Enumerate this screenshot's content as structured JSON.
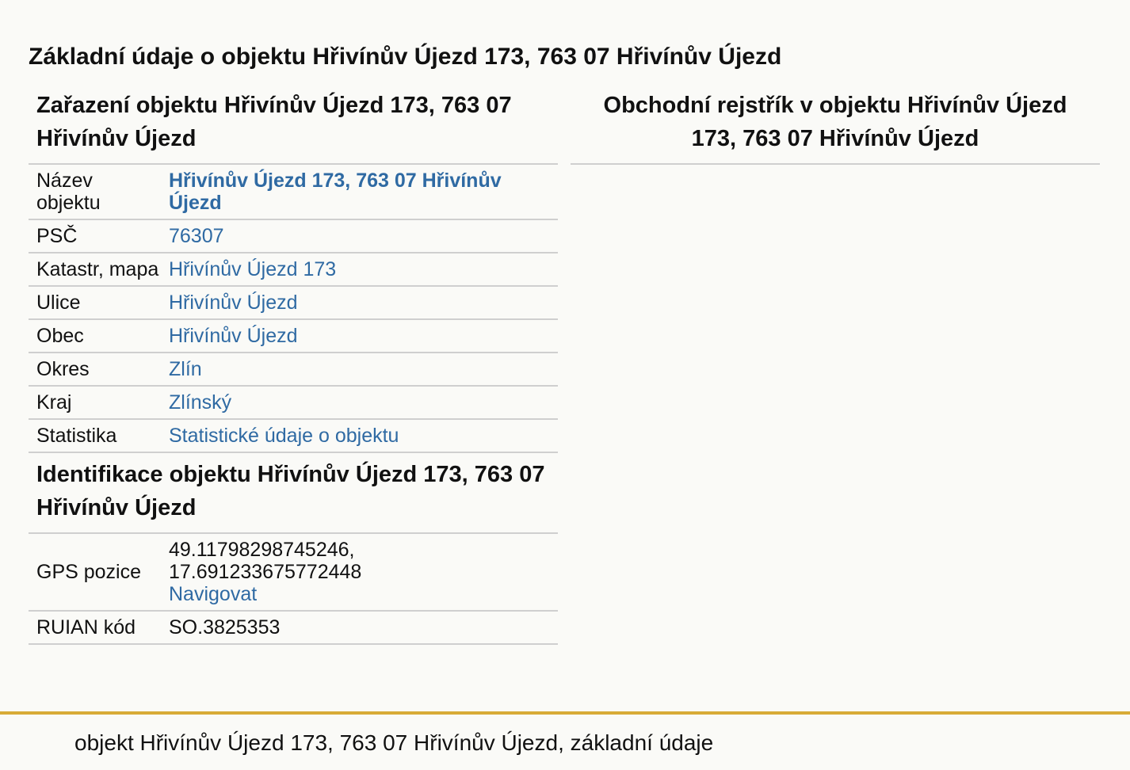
{
  "page": {
    "title": "Základní údaje o objektu Hřivínův Újezd 173, 763 07 Hřivínův Újezd"
  },
  "classification": {
    "title": "Zařazení objektu Hřivínův Újezd 173, 763 07 Hřivínův Újezd",
    "rows": [
      {
        "label": "Název objektu",
        "value": "Hřivínův Újezd 173, 763 07 Hřivínův Újezd"
      },
      {
        "label": "PSČ",
        "value": "76307"
      },
      {
        "label": "Katastr, mapa",
        "value": "Hřivínův Újezd 173"
      },
      {
        "label": "Ulice",
        "value": "Hřivínův Újezd"
      },
      {
        "label": "Obec",
        "value": "Hřivínův Újezd"
      },
      {
        "label": "Okres",
        "value": "Zlín"
      },
      {
        "label": "Kraj",
        "value": "Zlínský"
      },
      {
        "label": "Statistika",
        "value": "Statistické údaje o objektu"
      }
    ]
  },
  "identification": {
    "title": "Identifikace objektu Hřivínův Újezd 173, 763 07 Hřivínův Újezd",
    "gps": {
      "label": "GPS pozice",
      "lat": "49.11798298745246,",
      "lon": "17.691233675772448",
      "navigate": "Navigovat"
    },
    "ruian": {
      "label": "RUIAN kód",
      "value": "SO.3825353"
    }
  },
  "business_register": {
    "title": "Obchodní rejstřík v objektu Hřivínův Újezd 173, 763 07 Hřivínův Újezd"
  },
  "footer": {
    "text": "objekt Hřivínův Újezd 173, 763 07 Hřivínův Újezd, základní údaje"
  },
  "colors": {
    "link": "#2f6aa3",
    "footer_accent": "#d8ab37",
    "background": "#fafaf7"
  }
}
